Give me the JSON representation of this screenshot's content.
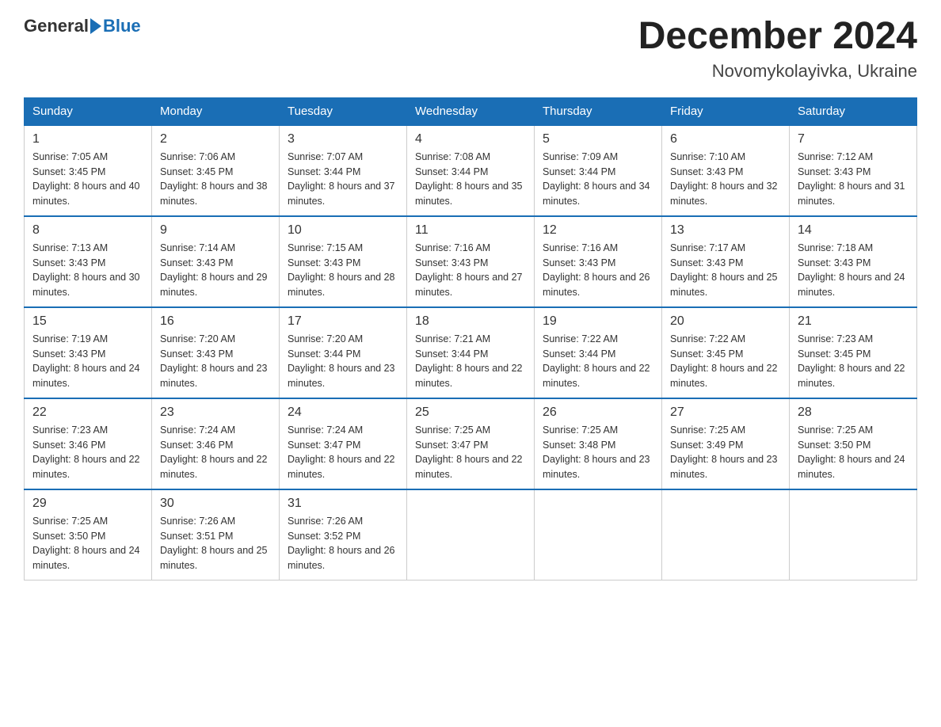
{
  "header": {
    "logo_general": "General",
    "logo_blue": "Blue",
    "title": "December 2024",
    "subtitle": "Novomykolayivka, Ukraine"
  },
  "days_of_week": [
    "Sunday",
    "Monday",
    "Tuesday",
    "Wednesday",
    "Thursday",
    "Friday",
    "Saturday"
  ],
  "weeks": [
    [
      {
        "day": "1",
        "sunrise": "7:05 AM",
        "sunset": "3:45 PM",
        "daylight": "8 hours and 40 minutes."
      },
      {
        "day": "2",
        "sunrise": "7:06 AM",
        "sunset": "3:45 PM",
        "daylight": "8 hours and 38 minutes."
      },
      {
        "day": "3",
        "sunrise": "7:07 AM",
        "sunset": "3:44 PM",
        "daylight": "8 hours and 37 minutes."
      },
      {
        "day": "4",
        "sunrise": "7:08 AM",
        "sunset": "3:44 PM",
        "daylight": "8 hours and 35 minutes."
      },
      {
        "day": "5",
        "sunrise": "7:09 AM",
        "sunset": "3:44 PM",
        "daylight": "8 hours and 34 minutes."
      },
      {
        "day": "6",
        "sunrise": "7:10 AM",
        "sunset": "3:43 PM",
        "daylight": "8 hours and 32 minutes."
      },
      {
        "day": "7",
        "sunrise": "7:12 AM",
        "sunset": "3:43 PM",
        "daylight": "8 hours and 31 minutes."
      }
    ],
    [
      {
        "day": "8",
        "sunrise": "7:13 AM",
        "sunset": "3:43 PM",
        "daylight": "8 hours and 30 minutes."
      },
      {
        "day": "9",
        "sunrise": "7:14 AM",
        "sunset": "3:43 PM",
        "daylight": "8 hours and 29 minutes."
      },
      {
        "day": "10",
        "sunrise": "7:15 AM",
        "sunset": "3:43 PM",
        "daylight": "8 hours and 28 minutes."
      },
      {
        "day": "11",
        "sunrise": "7:16 AM",
        "sunset": "3:43 PM",
        "daylight": "8 hours and 27 minutes."
      },
      {
        "day": "12",
        "sunrise": "7:16 AM",
        "sunset": "3:43 PM",
        "daylight": "8 hours and 26 minutes."
      },
      {
        "day": "13",
        "sunrise": "7:17 AM",
        "sunset": "3:43 PM",
        "daylight": "8 hours and 25 minutes."
      },
      {
        "day": "14",
        "sunrise": "7:18 AM",
        "sunset": "3:43 PM",
        "daylight": "8 hours and 24 minutes."
      }
    ],
    [
      {
        "day": "15",
        "sunrise": "7:19 AM",
        "sunset": "3:43 PM",
        "daylight": "8 hours and 24 minutes."
      },
      {
        "day": "16",
        "sunrise": "7:20 AM",
        "sunset": "3:43 PM",
        "daylight": "8 hours and 23 minutes."
      },
      {
        "day": "17",
        "sunrise": "7:20 AM",
        "sunset": "3:44 PM",
        "daylight": "8 hours and 23 minutes."
      },
      {
        "day": "18",
        "sunrise": "7:21 AM",
        "sunset": "3:44 PM",
        "daylight": "8 hours and 22 minutes."
      },
      {
        "day": "19",
        "sunrise": "7:22 AM",
        "sunset": "3:44 PM",
        "daylight": "8 hours and 22 minutes."
      },
      {
        "day": "20",
        "sunrise": "7:22 AM",
        "sunset": "3:45 PM",
        "daylight": "8 hours and 22 minutes."
      },
      {
        "day": "21",
        "sunrise": "7:23 AM",
        "sunset": "3:45 PM",
        "daylight": "8 hours and 22 minutes."
      }
    ],
    [
      {
        "day": "22",
        "sunrise": "7:23 AM",
        "sunset": "3:46 PM",
        "daylight": "8 hours and 22 minutes."
      },
      {
        "day": "23",
        "sunrise": "7:24 AM",
        "sunset": "3:46 PM",
        "daylight": "8 hours and 22 minutes."
      },
      {
        "day": "24",
        "sunrise": "7:24 AM",
        "sunset": "3:47 PM",
        "daylight": "8 hours and 22 minutes."
      },
      {
        "day": "25",
        "sunrise": "7:25 AM",
        "sunset": "3:47 PM",
        "daylight": "8 hours and 22 minutes."
      },
      {
        "day": "26",
        "sunrise": "7:25 AM",
        "sunset": "3:48 PM",
        "daylight": "8 hours and 23 minutes."
      },
      {
        "day": "27",
        "sunrise": "7:25 AM",
        "sunset": "3:49 PM",
        "daylight": "8 hours and 23 minutes."
      },
      {
        "day": "28",
        "sunrise": "7:25 AM",
        "sunset": "3:50 PM",
        "daylight": "8 hours and 24 minutes."
      }
    ],
    [
      {
        "day": "29",
        "sunrise": "7:25 AM",
        "sunset": "3:50 PM",
        "daylight": "8 hours and 24 minutes."
      },
      {
        "day": "30",
        "sunrise": "7:26 AM",
        "sunset": "3:51 PM",
        "daylight": "8 hours and 25 minutes."
      },
      {
        "day": "31",
        "sunrise": "7:26 AM",
        "sunset": "3:52 PM",
        "daylight": "8 hours and 26 minutes."
      },
      null,
      null,
      null,
      null
    ]
  ]
}
